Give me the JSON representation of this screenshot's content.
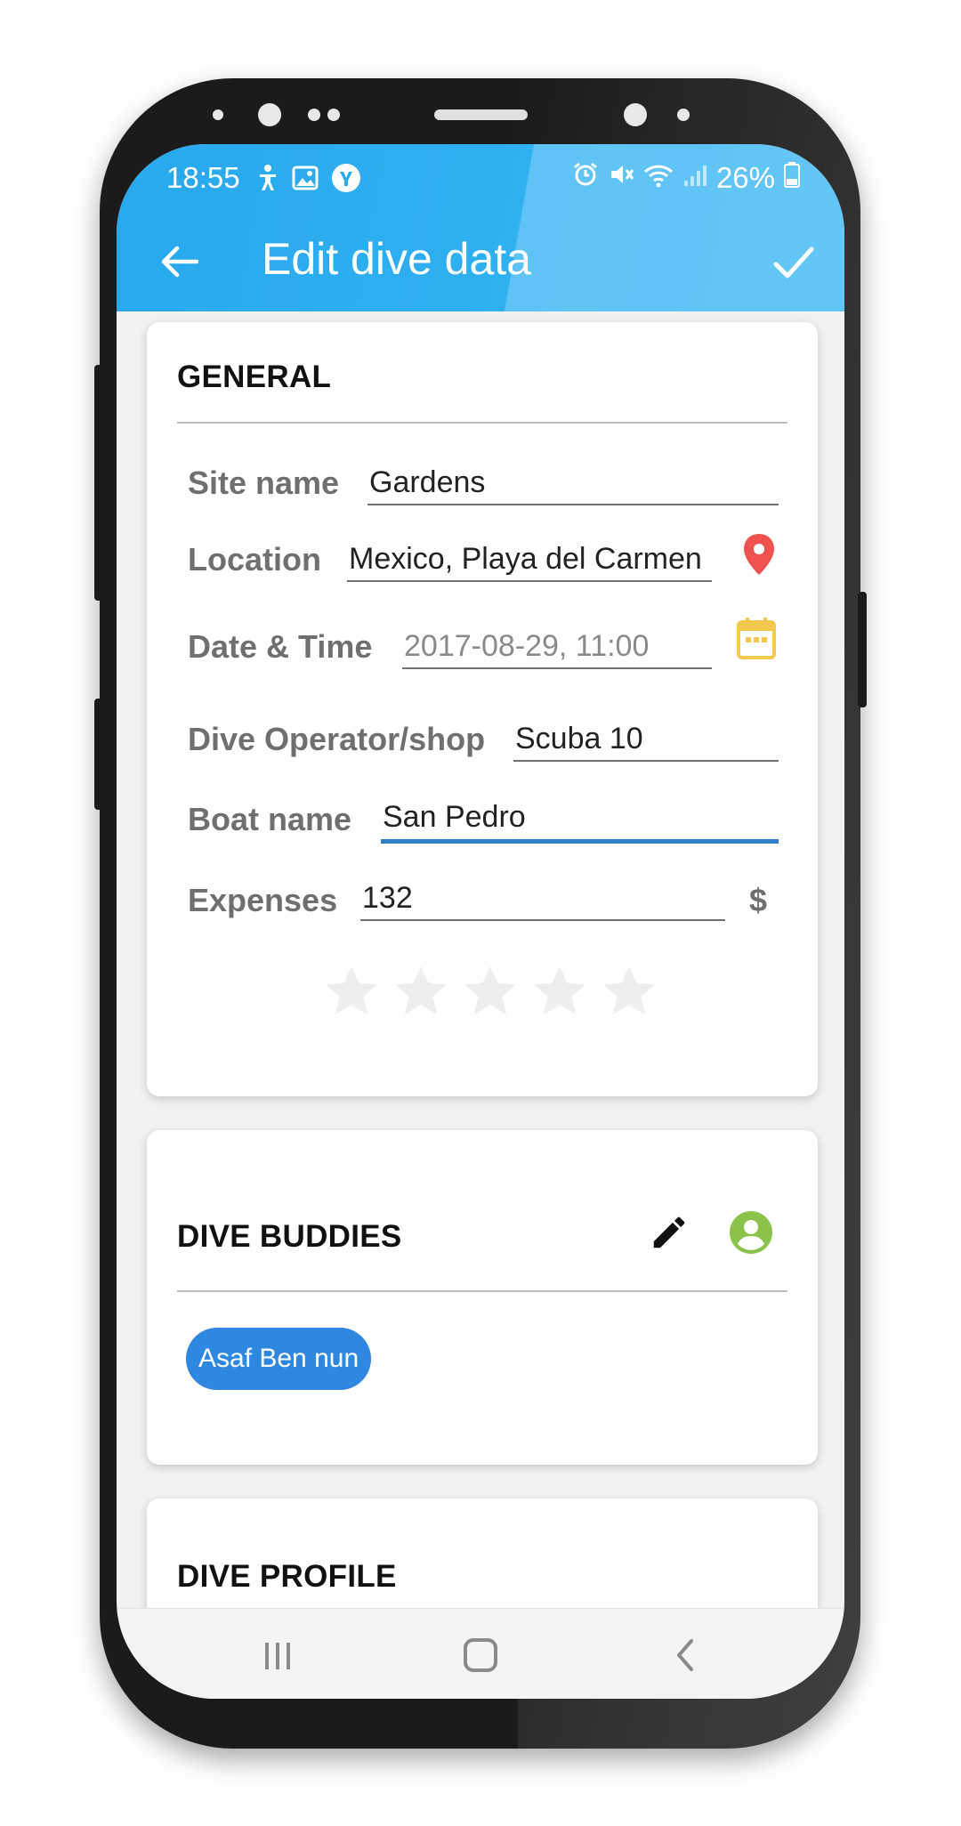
{
  "status_bar": {
    "time": "18:55",
    "battery": "26%",
    "left_icons": [
      "accessibility-icon",
      "image-icon",
      "yahoo-icon"
    ],
    "right_icons": [
      "alarm-icon",
      "mute-icon",
      "wifi-icon",
      "signal-icon",
      "battery-icon"
    ]
  },
  "app_bar": {
    "title": "Edit dive data",
    "back_icon": "back-arrow-icon",
    "save_icon": "checkmark-icon",
    "color": "#2aaaef"
  },
  "general": {
    "heading": "GENERAL",
    "site_name": {
      "label": "Site name",
      "value": "Gardens"
    },
    "location": {
      "label": "Location",
      "value": "Mexico, Playa del Carmen",
      "icon": "map-pin-icon",
      "icon_color": "#ef5350"
    },
    "date_time": {
      "label": "Date & Time",
      "value": "2017-08-29, 11:00",
      "icon": "calendar-icon",
      "icon_color": "#f2c94c"
    },
    "dive_operator": {
      "label": "Dive Operator/shop",
      "value": "Scuba 10"
    },
    "boat_name": {
      "label": "Boat name",
      "value": "San Pedro"
    },
    "expenses": {
      "label": "Expenses",
      "value": "132",
      "currency": "$"
    },
    "rating": {
      "value": 0,
      "max": 5
    }
  },
  "dive_buddies": {
    "heading": "DIVE BUDDIES",
    "edit_icon": "pencil-icon",
    "add_icon": "person-circle-icon",
    "add_icon_color": "#8bc34a",
    "buddies": [
      "Asaf Ben nun"
    ],
    "chip_color": "#2f88e0"
  },
  "dive_profile": {
    "heading": "DIVE PROFILE"
  },
  "nav_bar": {
    "icons": [
      "recents-icon",
      "home-icon",
      "back-icon"
    ]
  }
}
